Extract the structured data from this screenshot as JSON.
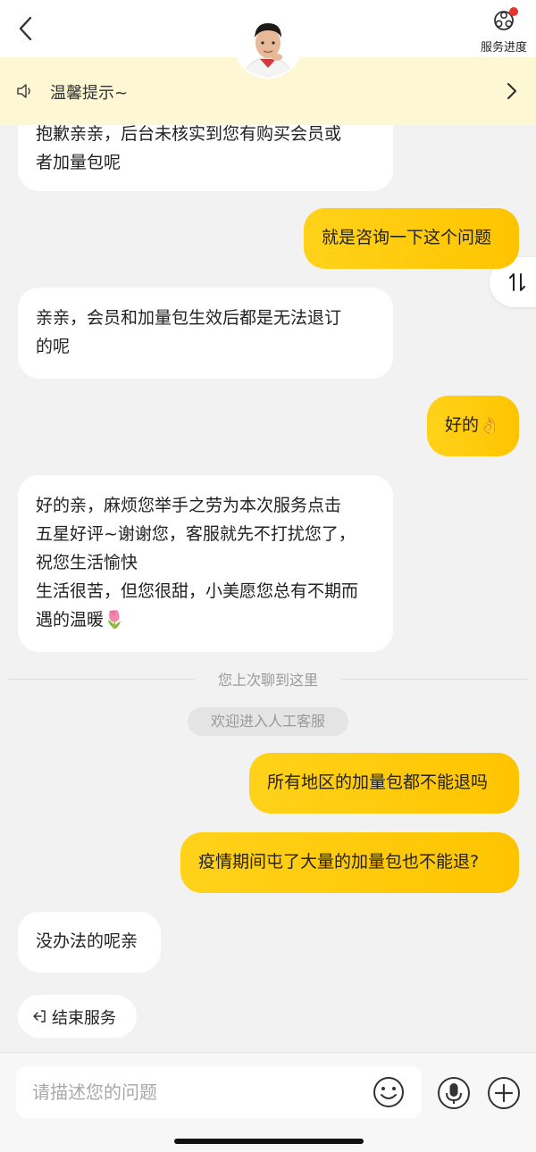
{
  "header": {
    "service_progress_label": "服务进度"
  },
  "notice": {
    "text": "温馨提示~"
  },
  "messages": [
    {
      "from": "agent",
      "lines": [
        "抱歉亲亲，后台未核实到您有购买会员或",
        "者加量包呢"
      ]
    },
    {
      "from": "user",
      "lines": [
        "就是咨询一下这个问题"
      ]
    },
    {
      "from": "agent",
      "lines": [
        "亲亲，会员和加量包生效后都是无法退订",
        "的呢"
      ]
    },
    {
      "from": "user",
      "lines": [
        "好的👌"
      ]
    },
    {
      "from": "agent",
      "lines": [
        "好的亲，麻烦您举手之劳为本次服务点击",
        "五星好评~谢谢您，客服就先不打扰您了，",
        "祝您生活愉快",
        "生活很苦，但您很甜，小美愿您总有不期而",
        "遇的温暖🌷"
      ]
    },
    {
      "from": "user",
      "lines": [
        "所有地区的加量包都不能退吗"
      ]
    },
    {
      "from": "user",
      "lines": [
        "疫情期间屯了大量的加量包也不能退?"
      ]
    },
    {
      "from": "agent",
      "lines": [
        "没办法的呢亲"
      ]
    }
  ],
  "divider_text": "您上次聊到这里",
  "system_notice": "欢迎进入人工客服",
  "end_service_label": "结束服务",
  "input": {
    "placeholder": "请描述您的问题",
    "value": ""
  },
  "colors": {
    "accent_yellow": "#ffc800",
    "agent_bubble": "#ffffff",
    "background": "#f2f2f2",
    "notice_bg": "#fdf7d4",
    "badge_red": "#e8352b"
  }
}
